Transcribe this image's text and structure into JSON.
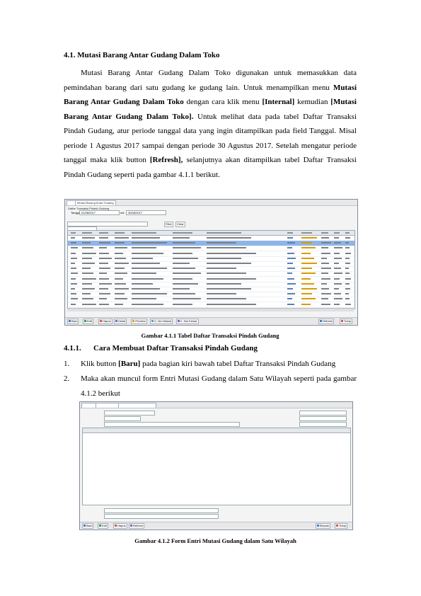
{
  "section_title": "4.1. Mutasi Barang Antar Gudang Dalam Toko",
  "paragraph": [
    {
      "t": "Mutasi Barang Antar Gudang Dalam Toko digunakan untuk memasukkan data pemindahan barang dari satu gudang ke gudang lain. Untuk menampilkan menu ",
      "b": false
    },
    {
      "t": "Mutasi Barang Antar Gudang Dalam Toko",
      "b": true
    },
    {
      "t": " dengan cara klik menu ",
      "b": false
    },
    {
      "t": "[Internal]",
      "b": true
    },
    {
      "t": " kemudian ",
      "b": false
    },
    {
      "t": "[Mutasi Barang Antar Gudang Dalam Toko].",
      "b": true
    },
    {
      "t": " Untuk melihat data pada tabel Daftar Transaksi Pindah Gudang, atur periode tanggal data yang ingin ditampilkan pada field Tanggal. Misal periode 1 Agustus 2017 sampai dengan periode 30 Agustus 2017. Setelah mengatur periode tanggal maka klik button ",
      "b": false
    },
    {
      "t": "[Refresh],",
      "b": true
    },
    {
      "t": " selanjutnya akan ditampilkan tabel Daftar Transaksi Pindah Gudang seperti pada gambar 4.1.1 berikut.",
      "b": false
    }
  ],
  "figure1": {
    "caption": "Gambar 4.1.1 Tabel Daftar Transaksi Pindah Gudang",
    "tab_label": "Mutasi Barang Antar Gudang",
    "subtab_label": "Daftar Transaksi Pindah Gudang",
    "filter_label": "Tanggal",
    "date_from": "01/08/2017",
    "date_to": "30/08/2017",
    "search_btn": "Filter",
    "clear_btn": "Clear",
    "buttons_left": [
      "Baru",
      "Edit",
      "Hapus",
      "Detail",
      "Preview",
      "C. Nm Masuk",
      "C. Nm Keluar"
    ],
    "buttons_right": [
      "Refresh",
      "Tutup"
    ],
    "row_count": 14,
    "selected_row": 1
  },
  "subsection": {
    "num": "4.1.1.",
    "title": "Cara Membuat Daftar Transaksi Pindah Gudang"
  },
  "steps": [
    {
      "n": "1.",
      "parts": [
        {
          "t": "Klik button ",
          "b": false
        },
        {
          "t": "[Baru]",
          "b": true
        },
        {
          "t": " pada bagian kiri bawah tabel Daftar Transaksi Pindah Gudang",
          "b": false
        }
      ]
    },
    {
      "n": "2.",
      "parts": [
        {
          "t": "Maka akan muncul form Entri Mutasi Gudang dalam Satu Wilayah seperti pada gambar 4.1.2 berikut",
          "b": false
        }
      ]
    }
  ],
  "figure2": {
    "caption": "Gambar 4.1.2 Form Entri Mutasi Gudang dalam Satu Wilayah",
    "buttons_left": [
      "Baru",
      "Edit",
      "Hapus",
      "Refresh"
    ],
    "buttons_right": [
      "Simpan",
      "Tutup"
    ]
  }
}
